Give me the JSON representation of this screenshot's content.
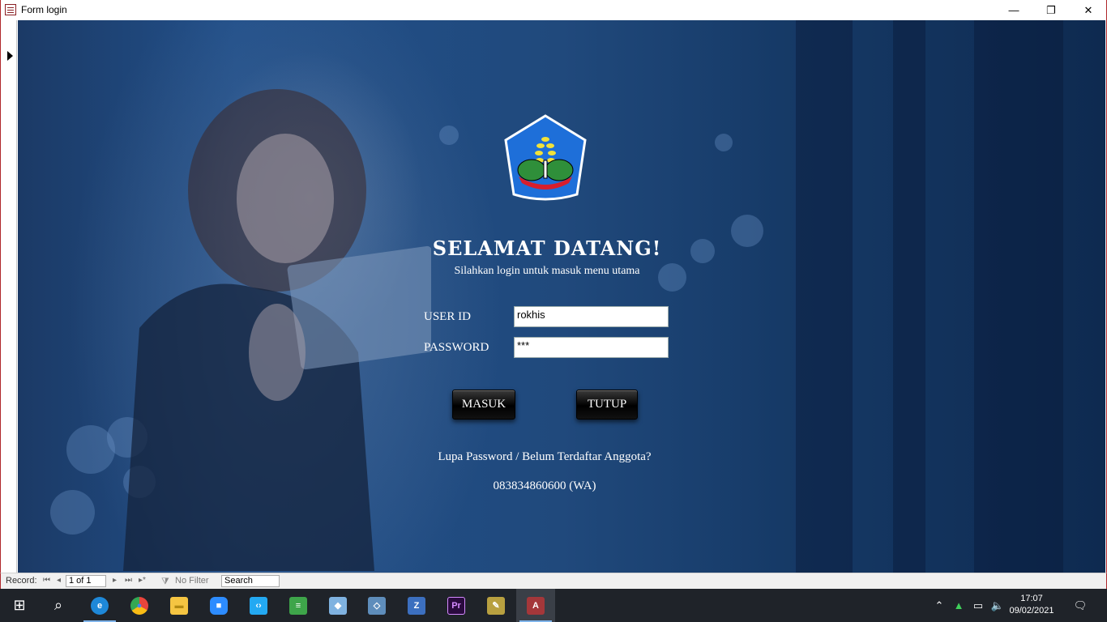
{
  "window": {
    "title": "Form login",
    "minimize_glyph": "—",
    "maximize_glyph": "❐",
    "close_glyph": "✕"
  },
  "form": {
    "welcome": "SELAMAT DATANG!",
    "subtitle": "Silahkan login untuk masuk menu utama",
    "user_label": "USER ID",
    "password_label": "PASSWORD",
    "user_value": "rokhis",
    "password_value": "***",
    "masuk_label": "MASUK",
    "tutup_label": "TUTUP",
    "forgot_text": "Lupa Password / Belum Terdaftar Anggota?",
    "wa_text": "083834860600 (WA)"
  },
  "record_nav": {
    "label": "Record:",
    "first_glyph": "⏮",
    "prev_glyph": "◂",
    "position": "1 of 1",
    "next_glyph": "▸",
    "last_glyph": "⏭",
    "new_glyph": "▸*",
    "filter_label": "No Filter",
    "search_value": "Search"
  },
  "taskbar": {
    "apps": [
      {
        "name": "start-icon",
        "glyph": "⊞"
      },
      {
        "name": "search-icon",
        "glyph": "⌕"
      },
      {
        "name": "edge-icon",
        "glyph": "e",
        "color": "#1e88d8"
      },
      {
        "name": "chrome-icon",
        "glyph": "●",
        "color": "#e8453c"
      },
      {
        "name": "file-explorer-icon",
        "glyph": "▬",
        "color": "#f5c542"
      },
      {
        "name": "zoom-icon",
        "glyph": "■",
        "color": "#2d8cff"
      },
      {
        "name": "vscode-icon",
        "glyph": "‹›",
        "color": "#23a9f2"
      },
      {
        "name": "spreadsheet-app-icon",
        "glyph": "≡",
        "color": "#3ea54a"
      },
      {
        "name": "cube-app-icon",
        "glyph": "◆",
        "color": "#7fb2e0"
      },
      {
        "name": "virtualbox-icon",
        "glyph": "◇",
        "color": "#9ec3e6"
      },
      {
        "name": "z-app-icon",
        "glyph": "Z",
        "color": "#3c6fbf"
      },
      {
        "name": "premiere-icon",
        "glyph": "Pr",
        "color": "#2a0a3e"
      },
      {
        "name": "tools-app-icon",
        "glyph": "✎",
        "color": "#b8a040"
      },
      {
        "name": "access-icon",
        "glyph": "A",
        "color": "#a4373a"
      }
    ],
    "time": "17:07",
    "date": "09/02/2021"
  },
  "colors": {
    "accent": "#b0282c",
    "overlay_blue": "#1f4b80",
    "logo_blue": "#1e6fd9"
  }
}
